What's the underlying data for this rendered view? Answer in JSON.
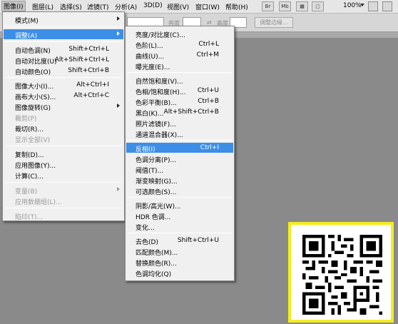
{
  "menubar": {
    "items": [
      {
        "label": "图像(I)",
        "active": true
      },
      {
        "label": "图层(L)"
      },
      {
        "label": "选择(S)"
      },
      {
        "label": "滤镜(T)"
      },
      {
        "label": "分析(A)"
      },
      {
        "label": "3D(D)"
      },
      {
        "label": "视图(V)"
      },
      {
        "label": "窗口(W)"
      },
      {
        "label": "帮助(H)"
      }
    ],
    "toolbar_buttons": [
      "Br",
      "Mb"
    ],
    "zoom": "100%"
  },
  "options_bar": {
    "label1": "亮度",
    "label2": "高度",
    "refine_button": "调整边缘..."
  },
  "image_menu": {
    "items": [
      {
        "label": "模式(M)",
        "arrow": true
      },
      {
        "sep": true
      },
      {
        "label": "调整(A)",
        "arrow": true,
        "highlighted": true
      },
      {
        "sep": true
      },
      {
        "label": "自动色调(N)",
        "shortcut": "Shift+Ctrl+L"
      },
      {
        "label": "自动对比度(U)",
        "shortcut": "Alt+Shift+Ctrl+L"
      },
      {
        "label": "自动颜色(O)",
        "shortcut": "Shift+Ctrl+B"
      },
      {
        "sep": true
      },
      {
        "label": "图像大小(I)...",
        "shortcut": "Alt+Ctrl+I"
      },
      {
        "label": "画布大小(S)...",
        "shortcut": "Alt+Ctrl+C"
      },
      {
        "label": "图像旋转(G)",
        "arrow": true
      },
      {
        "label": "裁剪(P)",
        "disabled": true
      },
      {
        "label": "裁切(R)..."
      },
      {
        "label": "显示全部(V)",
        "disabled": true
      },
      {
        "sep": true
      },
      {
        "label": "复制(D)..."
      },
      {
        "label": "应用图像(Y)..."
      },
      {
        "label": "计算(C)..."
      },
      {
        "sep": true
      },
      {
        "label": "变量(B)",
        "arrow": true,
        "disabled": true
      },
      {
        "label": "应用数据组(L)...",
        "disabled": true
      },
      {
        "sep": true
      },
      {
        "label": "陷印(T)...",
        "disabled": true
      }
    ]
  },
  "adjust_menu": {
    "items": [
      {
        "label": "亮度/对比度(C)..."
      },
      {
        "label": "色阶(L)...",
        "shortcut": "Ctrl+L"
      },
      {
        "label": "曲线(U)...",
        "shortcut": "Ctrl+M"
      },
      {
        "label": "曝光度(E)..."
      },
      {
        "sep": true
      },
      {
        "label": "自然饱和度(V)..."
      },
      {
        "label": "色相/饱和度(H)...",
        "shortcut": "Ctrl+U"
      },
      {
        "label": "色彩平衡(B)...",
        "shortcut": "Ctrl+B"
      },
      {
        "label": "黑白(K)...",
        "shortcut": "Alt+Shift+Ctrl+B"
      },
      {
        "label": "照片滤镜(F)..."
      },
      {
        "label": "通道混合器(X)..."
      },
      {
        "sep": true
      },
      {
        "label": "反相(I)",
        "shortcut": "Ctrl+I",
        "highlighted": true
      },
      {
        "label": "色调分离(P)..."
      },
      {
        "label": "阈值(T)..."
      },
      {
        "label": "渐变映射(G)..."
      },
      {
        "label": "可选颜色(S)..."
      },
      {
        "sep": true
      },
      {
        "label": "阴影/高光(W)..."
      },
      {
        "label": "HDR 色调..."
      },
      {
        "label": "变化..."
      },
      {
        "sep": true
      },
      {
        "label": "去色(D)",
        "shortcut": "Shift+Ctrl+U"
      },
      {
        "label": "匹配颜色(M)..."
      },
      {
        "label": "替换颜色(R)..."
      },
      {
        "label": "色调均化(Q)"
      }
    ]
  },
  "colors": {
    "highlight": "#3d8ee6",
    "qr_frame": "#f5ec1c"
  }
}
